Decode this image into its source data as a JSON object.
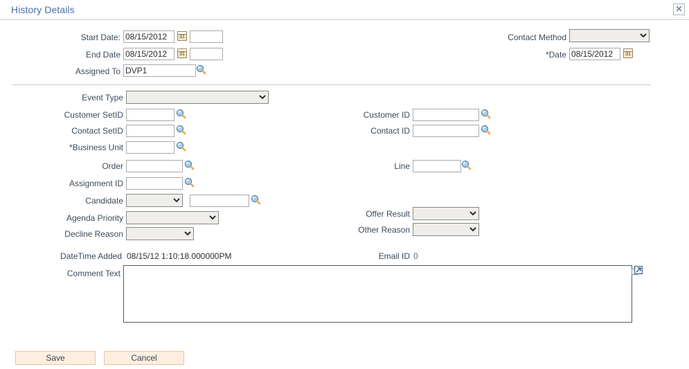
{
  "window": {
    "title": "History Details",
    "close_label": "✕",
    "close_icon": "close-icon"
  },
  "colors": {
    "title_blue": "#4a6fa5",
    "label_slate": "#3b4a5a",
    "rule_gray": "#c9c9c9",
    "header_rule": "#c6d0dd",
    "button_face": "#fdeee0",
    "button_border": "#e3c7a6",
    "dropdown_face": "#f0eeea",
    "link_blue": "#4a6fa5"
  },
  "top_section": {
    "start_date": {
      "label": "Start Date:",
      "value": "08/15/2012",
      "calendar_icon": "calendar-icon",
      "calendar_day": "31",
      "secondary_value": "",
      "secondary_placeholder": ""
    },
    "end_date": {
      "label": "End Date",
      "value": "08/15/2012",
      "calendar_icon": "calendar-icon",
      "calendar_day": "31",
      "secondary_value": "",
      "secondary_placeholder": ""
    },
    "assigned_to": {
      "label": "Assigned To",
      "value": "DVP1",
      "lookup_icon": "magnifier-icon"
    },
    "contact_method": {
      "label": "Contact Method",
      "value": "",
      "options": [
        ""
      ]
    },
    "date": {
      "label": "*Date",
      "value": "08/15/2012",
      "calendar_icon": "calendar-icon",
      "calendar_day": "31"
    }
  },
  "detail_section": {
    "event_type": {
      "label": "Event Type",
      "value": "",
      "options": [
        ""
      ]
    },
    "customer_setid": {
      "label": "Customer SetID",
      "value": "",
      "lookup_icon": "magnifier-icon"
    },
    "contact_setid": {
      "label": "Contact SetID",
      "value": "",
      "lookup_icon": "magnifier-icon"
    },
    "business_unit": {
      "label": "*Business Unit",
      "value": "",
      "lookup_icon": "magnifier-icon"
    },
    "order": {
      "label": "Order",
      "value": "",
      "lookup_icon": "magnifier-icon"
    },
    "assignment_id": {
      "label": "Assignment ID",
      "value": "",
      "lookup_icon": "magnifier-icon"
    },
    "candidate": {
      "label": "Candidate",
      "select_value": "",
      "select_options": [
        ""
      ],
      "text_value": "",
      "lookup_icon": "magnifier-icon"
    },
    "agenda_priority": {
      "label": "Agenda Priority",
      "value": "",
      "options": [
        ""
      ]
    },
    "decline_reason": {
      "label": "Decline Reason",
      "value": "",
      "options": [
        ""
      ]
    },
    "customer_id": {
      "label": "Customer ID",
      "value": "",
      "lookup_icon": "magnifier-icon"
    },
    "contact_id": {
      "label": "Contact ID",
      "value": "",
      "lookup_icon": "magnifier-icon"
    },
    "line": {
      "label": "Line",
      "value": "",
      "lookup_icon": "magnifier-icon"
    },
    "offer_result": {
      "label": "Offer Result",
      "value": "",
      "options": [
        ""
      ]
    },
    "other_reason": {
      "label": "Other Reason",
      "value": "",
      "options": [
        ""
      ]
    }
  },
  "readonly_section": {
    "datetime_added": {
      "label": "DateTime Added",
      "value": "08/15/12  1:10:18.000000PM"
    },
    "email_id": {
      "label": "Email ID",
      "value": "0"
    }
  },
  "comment": {
    "label": "Comment Text",
    "value": "",
    "placeholder": "",
    "expand_icon": "expand-icon"
  },
  "actions": {
    "save_label": "Save",
    "cancel_label": "Cancel"
  }
}
